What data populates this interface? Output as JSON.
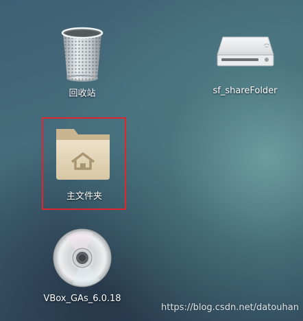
{
  "desktop": {
    "icons": [
      {
        "label": "回收站",
        "icon": "trash-icon"
      },
      {
        "label": "sf_shareFolder",
        "icon": "drive-icon"
      },
      {
        "label": "主文件夹",
        "icon": "home-folder-icon"
      },
      {
        "label": "VBox_GAs_6.0.18",
        "icon": "optical-disc-icon"
      }
    ],
    "selection_color": "#e0262d"
  },
  "watermark": "https://blog.csdn.net/datouhan"
}
